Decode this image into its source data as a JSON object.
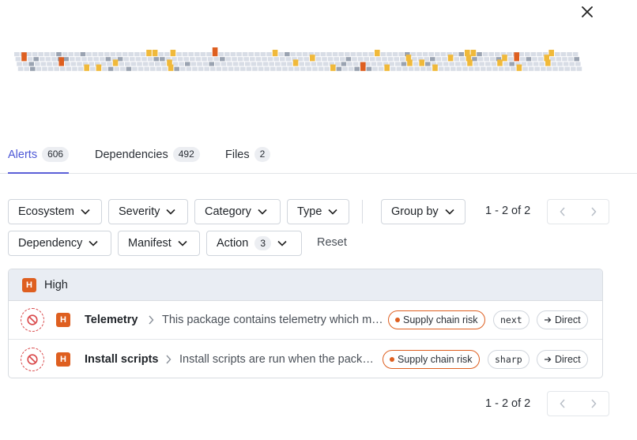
{
  "header": {
    "close_icon": "close-icon"
  },
  "visualization": {
    "colors": {
      "low": "#d8dde6",
      "medium": "#f0b93a",
      "high": "#de5f20",
      "neutral": "#9aa3b1"
    }
  },
  "tabs": [
    {
      "label": "Alerts",
      "count": "606",
      "active": true
    },
    {
      "label": "Dependencies",
      "count": "492",
      "active": false
    },
    {
      "label": "Files",
      "count": "2",
      "active": false
    }
  ],
  "filters": {
    "ecosystem": "Ecosystem",
    "severity": "Severity",
    "category": "Category",
    "type": "Type",
    "group_by": "Group by",
    "dependency": "Dependency",
    "manifest": "Manifest",
    "action": "Action",
    "action_count": "3",
    "reset": "Reset"
  },
  "pagination": {
    "top_text": "1 - 2 of 2",
    "bottom_text": "1 - 2 of 2"
  },
  "group": {
    "badge": "H",
    "label": "High"
  },
  "rows": [
    {
      "badge": "H",
      "title": "Telemetry",
      "description": "This package contains telemetry which may send data to third parties",
      "risk": "Supply chain risk",
      "package": "next",
      "dependency": "Direct"
    },
    {
      "badge": "H",
      "title": "Install scripts",
      "description": "Install scripts are run when the package is installed",
      "risk": "Supply chain risk",
      "package": "sharp",
      "dependency": "Direct"
    }
  ],
  "colors": {
    "accent": "#5b60d8",
    "severity_high": "#de5f20",
    "ignore_red": "#d9484a",
    "group_bg": "#e9edf3"
  }
}
